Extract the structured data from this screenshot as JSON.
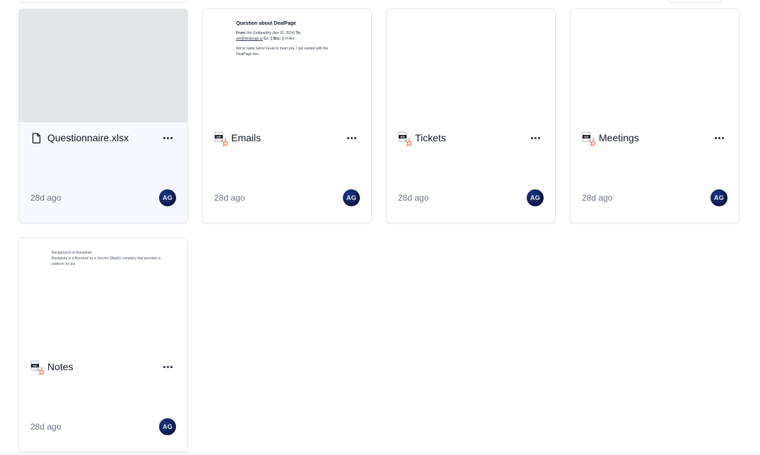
{
  "cards": [
    {
      "title": "Questionnaire.xlsx",
      "icon": "file-icon",
      "age": "28d ago",
      "avatar": "AG"
    },
    {
      "title": "Emails",
      "icon": "hubspot-md-icon",
      "age": "28d ago",
      "avatar": "AG",
      "preview": {
        "subject": "Question about DealPage",
        "from_label": "From:",
        "from_value": "Ani Gottipartthy (Apr 02, 2024)",
        "to_label": "To:",
        "to_value": "ani@dealpage.ai",
        "cc_label": "Cc:",
        "cc_value": "[]",
        "bcc_label": "Bcc:",
        "bcc_value": "[] Hi Ani,",
        "body": "We're name twins! Great to meet you. I got started with the DealPage free"
      }
    },
    {
      "title": "Tickets",
      "icon": "hubspot-md-icon",
      "age": "28d ago",
      "avatar": "AG"
    },
    {
      "title": "Meetings",
      "icon": "hubspot-md-icon",
      "age": "28d ago",
      "avatar": "AG"
    },
    {
      "title": "Notes",
      "icon": "hubspot-md-icon",
      "age": "28d ago",
      "avatar": "AG",
      "preview": {
        "line1": "Background on Baseplate",
        "line2": "Baseplate is a Backend as a Service (BaaS) company that provides a platform for bui"
      }
    }
  ],
  "colors": {
    "accent_hubspot": "#ff7a59",
    "avatar": "#0b1b4d",
    "border": "#e5e7eb"
  }
}
